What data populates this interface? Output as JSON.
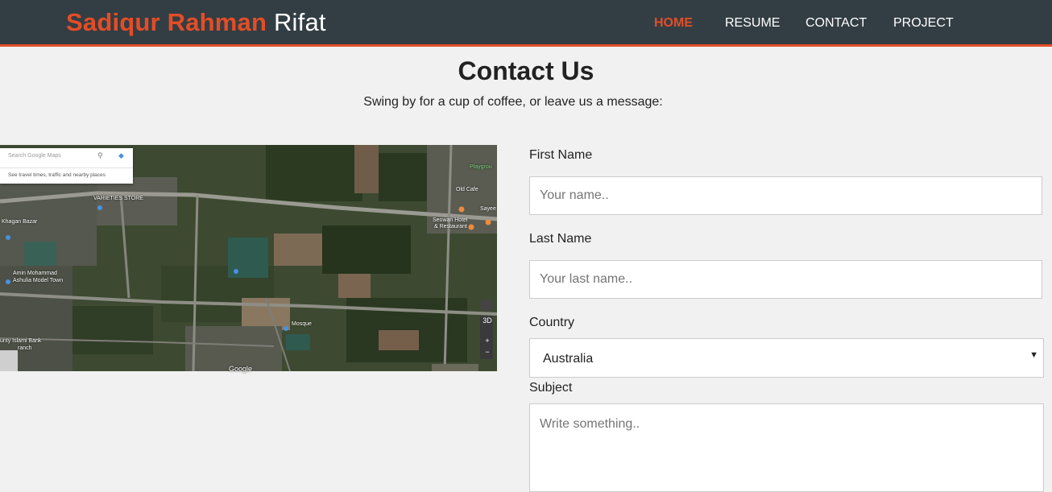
{
  "header": {
    "brand_first": "Sadiqur Rahman",
    "brand_last": "Rifat",
    "nav": [
      {
        "label": "HOME",
        "active": true
      },
      {
        "label": "RESUME",
        "active": false
      },
      {
        "label": "CONTACT",
        "active": false
      },
      {
        "label": "PROJECT",
        "active": false
      }
    ]
  },
  "colors": {
    "accent": "#e44d26",
    "header_bg": "#333e44",
    "page_bg": "#f1f1f1"
  },
  "contact": {
    "title": "Contact Us",
    "subtitle": "Swing by for a cup of coffee, or leave us a message:"
  },
  "map": {
    "search_placeholder": "Search Google Maps",
    "search_hint": "See travel times, traffic and nearby places",
    "labels": {
      "varieties": "VARIETIES STORE",
      "khagan": "Khagan Bazar",
      "amin": "Amin Mohammad",
      "ashulia": "Ashulia Model Town",
      "bank": "unty Islami Bank",
      "ranch": "ranch",
      "cafe": "Old Cafe",
      "playground": "Playgrou",
      "seowan": "Seowan Hotel",
      "restaurant": "& Restaurant",
      "sayeed": "Sayee",
      "mosque": "Mosque"
    },
    "google_logo": "Google",
    "controls": {
      "tilt": "3D",
      "zoom_in": "+",
      "zoom_out": "−"
    }
  },
  "form": {
    "first_name_label": "First Name",
    "first_name_placeholder": "Your name..",
    "last_name_label": "Last Name",
    "last_name_placeholder": "Your last name..",
    "country_label": "Country",
    "country_value": "Australia",
    "subject_label": "Subject",
    "subject_placeholder": "Write something.."
  },
  "icons": {
    "search": "search-icon",
    "directions": "directions-icon",
    "dropdown": "chevron-down-icon"
  }
}
